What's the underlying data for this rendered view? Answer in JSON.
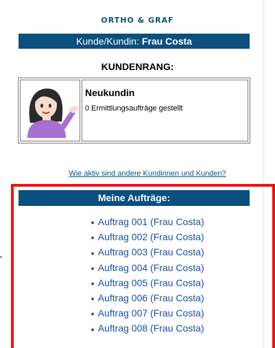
{
  "brand": "ORTHO & GRAF",
  "customer": {
    "label": "Kunde/Kundin:",
    "name": "Frau Costa"
  },
  "rank": {
    "heading": "KUNDENRANG:",
    "title": "Neukundin",
    "subtitle": "0 Ermittlungsaufträge gestellt",
    "avatar_icon": "woman-tipping-hand-icon"
  },
  "compare_link": "Wie aktiv sind andere Kundinnen und Kunden?",
  "orders": {
    "heading": "Meine Aufträge:",
    "items": [
      "Auftrag 001 (Frau Costa)",
      "Auftrag 002 (Frau Costa)",
      "Auftrag 003 (Frau Costa)",
      "Auftrag 004 (Frau Costa)",
      "Auftrag 005 (Frau Costa)",
      "Auftrag 006 (Frau Costa)",
      "Auftrag 007 (Frau Costa)",
      "Auftrag 008 (Frau Costa)"
    ]
  },
  "colors": {
    "accent": "#0b4f7e",
    "link": "#1c4fa0",
    "highlight": "#ee1111"
  }
}
